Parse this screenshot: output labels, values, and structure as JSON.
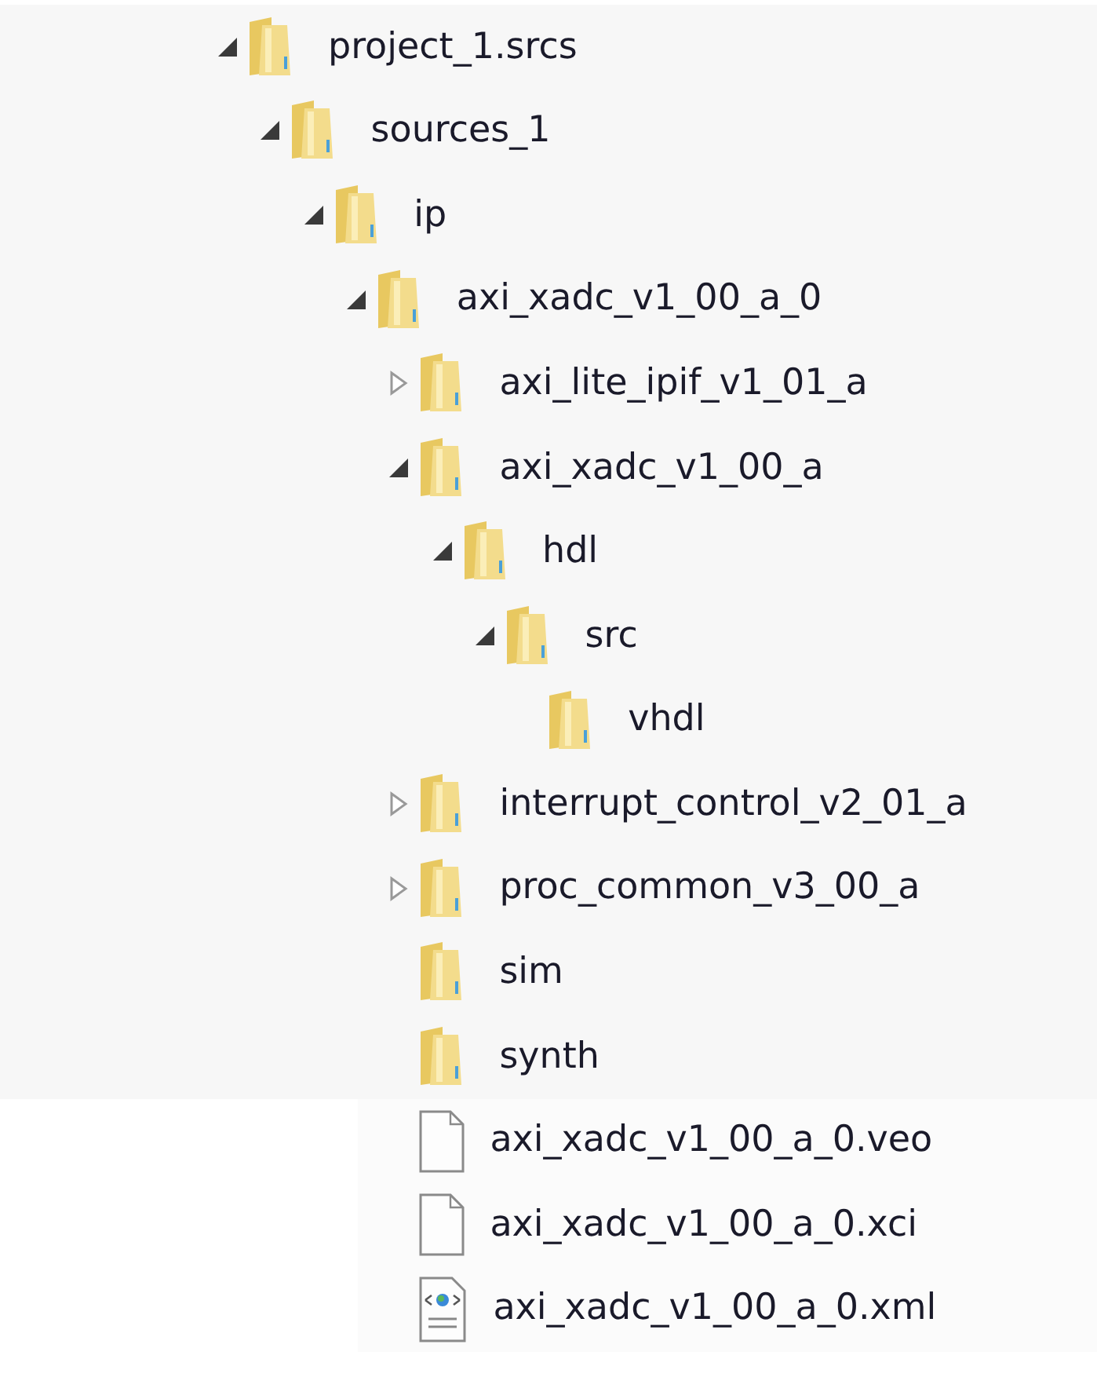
{
  "tree": [
    {
      "kind": "folder",
      "label": "project_1.srcs",
      "expanded": true,
      "children": [
        {
          "kind": "folder",
          "label": "sources_1",
          "expanded": true,
          "children": [
            {
              "kind": "folder",
              "label": "ip",
              "expanded": true,
              "children": [
                {
                  "kind": "folder",
                  "label": "axi_xadc_v1_00_a_0",
                  "expanded": true,
                  "children": [
                    {
                      "kind": "folder",
                      "label": "axi_lite_ipif_v1_01_a",
                      "expanded": false
                    },
                    {
                      "kind": "folder",
                      "label": "axi_xadc_v1_00_a",
                      "expanded": true,
                      "children": [
                        {
                          "kind": "folder",
                          "label": "hdl",
                          "expanded": true,
                          "children": [
                            {
                              "kind": "folder",
                              "label": "src",
                              "expanded": true,
                              "children": [
                                {
                                  "kind": "folder",
                                  "label": "vhdl"
                                }
                              ]
                            }
                          ]
                        }
                      ]
                    },
                    {
                      "kind": "folder",
                      "label": "interrupt_control_v2_01_a",
                      "expanded": false
                    },
                    {
                      "kind": "folder",
                      "label": "proc_common_v3_00_a",
                      "expanded": false
                    },
                    {
                      "kind": "folder",
                      "label": "sim"
                    },
                    {
                      "kind": "folder",
                      "label": "synth"
                    },
                    {
                      "kind": "file",
                      "label": "axi_xadc_v1_00_a_0.veo"
                    },
                    {
                      "kind": "file",
                      "label": "axi_xadc_v1_00_a_0.xci"
                    },
                    {
                      "kind": "xml-file",
                      "label": "axi_xadc_v1_00_a_0.xml"
                    }
                  ]
                }
              ]
            }
          ]
        }
      ]
    }
  ]
}
